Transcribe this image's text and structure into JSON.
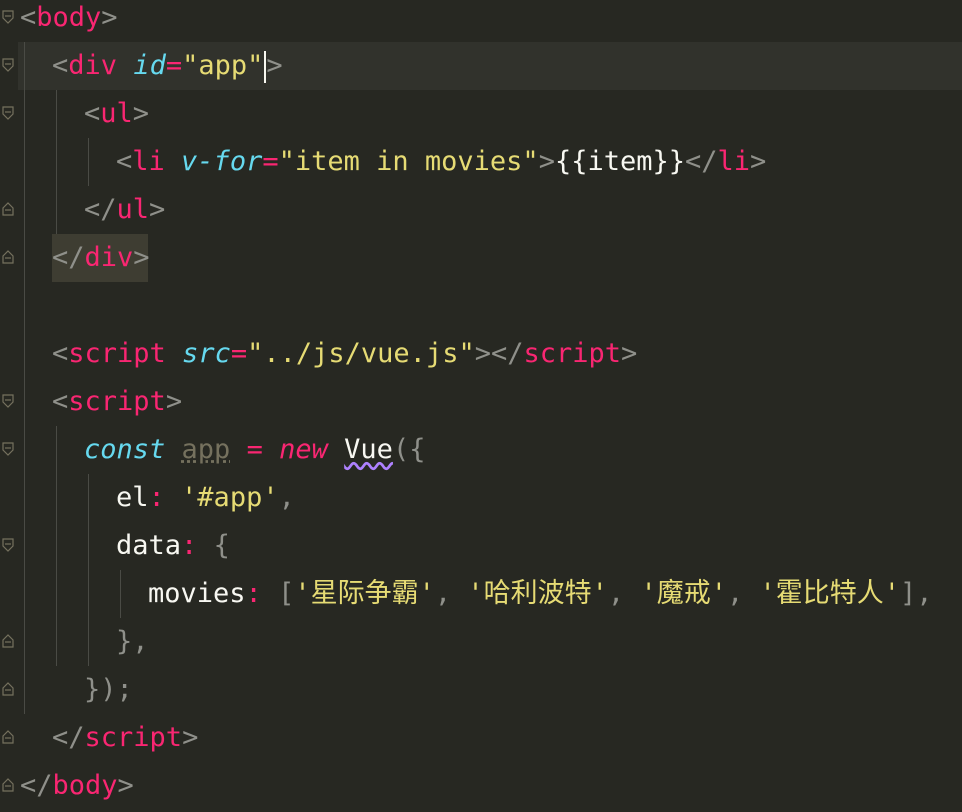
{
  "editor": {
    "theme": "dark-monokai",
    "colors": {
      "background": "#272822",
      "tag": "#F92672",
      "attribute": "#66D9EF",
      "string": "#E6DB74",
      "text": "#F8F8F2",
      "punctuation": "#8F908A"
    },
    "lines": {
      "l1": {
        "open": "<",
        "tag": "body",
        "close": ">"
      },
      "l2": {
        "open": "<",
        "tag": "div",
        "attr": "id",
        "eq": "=",
        "val": "\"app\"",
        "close": ">"
      },
      "l3": {
        "open": "<",
        "tag": "ul",
        "close": ">"
      },
      "l4": {
        "open": "<",
        "tag": "li",
        "attr": "v-for",
        "eq": "=",
        "val": "\"item in movies\"",
        "close": ">",
        "text": "{{item}}",
        "endopen": "</",
        "endtag": "li",
        "endclose": ">"
      },
      "l5": {
        "open": "</",
        "tag": "ul",
        "close": ">"
      },
      "l6": {
        "open": "</",
        "tag": "div",
        "close": ">"
      },
      "l7": {
        "open": "<",
        "tag": "script",
        "attr": "src",
        "eq": "=",
        "val": "\"../js/vue.js\"",
        "close": ">",
        "endopen": "</",
        "endtag": "script",
        "endclose": ">"
      },
      "l8": {
        "open": "<",
        "tag": "script",
        "close": ">"
      },
      "l9": {
        "kw": "const",
        "name": "app",
        "op": "=",
        "newkw": "new",
        "cls": "Vue",
        "rest": "({"
      },
      "l10": {
        "key": "el",
        "colon": ":",
        "val": "'#app'",
        "comma": ","
      },
      "l11": {
        "key": "data",
        "colon": ":",
        "rest": "{"
      },
      "l12": {
        "key": "movies",
        "colon": ":",
        "open": "[",
        "v1": "'星际争霸'",
        "v2": "'哈利波特'",
        "v3": "'魔戒'",
        "v4": "'霍比特人'",
        "sep": ",",
        "close": "],"
      },
      "l13": {
        "text": "},"
      },
      "l14": {
        "text": "});"
      },
      "l15": {
        "open": "</",
        "tag": "script",
        "close": ">"
      },
      "l16": {
        "open": "</",
        "tag": "body",
        "close": ">"
      }
    }
  }
}
